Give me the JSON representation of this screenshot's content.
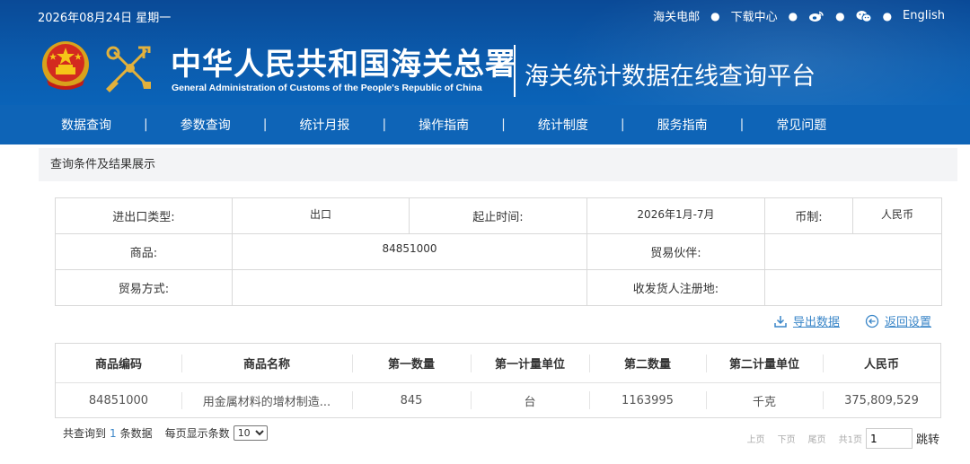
{
  "header": {
    "date": "2026年08月24日 星期一",
    "links": {
      "mail": "海关电邮",
      "download": "下载中心",
      "english": "English"
    },
    "org_cn": "中华人民共和国海关总署",
    "org_en": "General Administration of Customs of the People's Republic of China",
    "platform_title": "海关统计数据在线查询平台",
    "icons": [
      "national-emblem",
      "customs-emblem",
      "weibo-icon",
      "wechat-icon"
    ]
  },
  "nav": {
    "items": [
      "数据查询",
      "参数查询",
      "统计月报",
      "操作指南",
      "统计制度",
      "服务指南",
      "常见问题"
    ],
    "separator": "|"
  },
  "section_title": "查询条件及结果展示",
  "query": {
    "trade_type_label": "进出口类型:",
    "trade_type_value": "出口",
    "period_label": "起止时间:",
    "period_value": "2026年1月-7月",
    "currency_label": "币制:",
    "currency_value": "人民币",
    "product_label": "商品:",
    "product_value": "84851000",
    "partner_label": "贸易伙伴:",
    "partner_value": "",
    "trade_mode_label": "贸易方式:",
    "trade_mode_value": "",
    "consignee_label": "收发货人注册地:",
    "consignee_value": ""
  },
  "actions": {
    "export": "导出数据",
    "back": "返回设置"
  },
  "results": {
    "columns": [
      "商品编码",
      "商品名称",
      "第一数量",
      "第一计量单位",
      "第二数量",
      "第二计量单位",
      "人民币"
    ],
    "rows": [
      [
        "84851000",
        "用金属材料的增材制造...",
        "845",
        "台",
        "1163995",
        "千克",
        "375,809,529"
      ]
    ]
  },
  "footer": {
    "total_prefix": "共查询到",
    "total_count": "1",
    "total_suffix": "条数据",
    "per_page_label": "每页显示条数",
    "per_page_value": "10",
    "pager": {
      "prev": "上页",
      "next": "下页",
      "last": "尾页",
      "total_pages": "共1页",
      "jump_value": "1",
      "jump_label": "跳转"
    }
  },
  "colors": {
    "header_blue": "#0a4a97",
    "nav_blue": "#0e64b7",
    "link_blue": "#3a86c8",
    "border_gray": "#d9d9d9",
    "section_bg": "#f3f4f6"
  }
}
